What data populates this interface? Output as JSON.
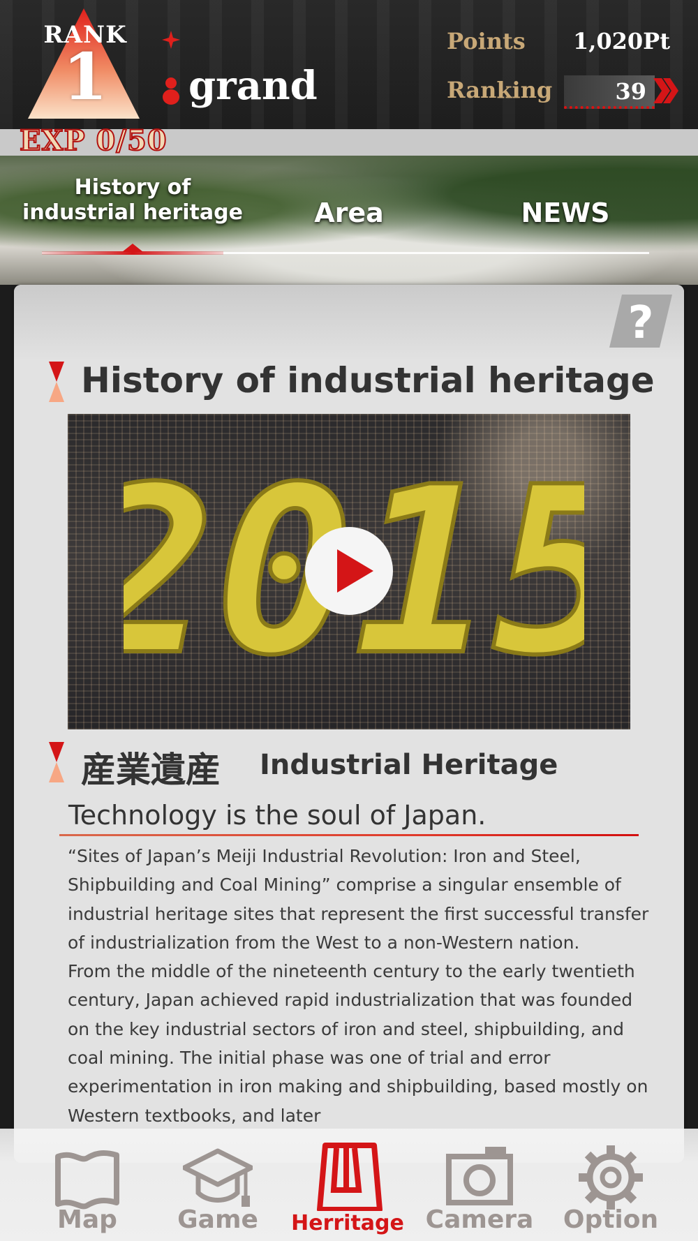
{
  "header": {
    "rank_label": "RANK",
    "rank_number": "1",
    "username": "grand",
    "points_label": "Points",
    "points_value": "1,020Pt",
    "ranking_label": "Ranking",
    "ranking_value": "39",
    "exp_text": "EXP 0/50"
  },
  "tabs": {
    "history_line1": "History of",
    "history_line2": "industrial heritage",
    "area": "Area",
    "news": "NEWS"
  },
  "content": {
    "heading": "History of industrial heritage",
    "video_year_text": "2015",
    "subheading_jp": "産業遺産",
    "subheading_en": "Industrial Heritage",
    "tagline": "Technology is the soul of Japan.",
    "paragraph1": "“Sites of Japan’s Meiji Industrial Revolution: Iron and Steel, Shipbuilding and Coal Mining” comprise a singular ensemble of industrial heritage sites that represent the first successful transfer of industrialization from the West to a non-Western nation.",
    "paragraph2": "From the middle of the nineteenth century to the early twentieth century, Japan achieved rapid industrialization that was founded on the key industrial sectors of iron and steel, shipbuilding, and coal mining. The initial phase was one of trial and error experimentation in iron making and shipbuilding, based mostly on Western textbooks, and later"
  },
  "nav": {
    "items": [
      {
        "label": "Map",
        "icon": "map-icon",
        "active": false
      },
      {
        "label": "Game",
        "icon": "graduation-cap-icon",
        "active": false
      },
      {
        "label": "Herritage",
        "icon": "heritage-building-icon",
        "active": true
      },
      {
        "label": "Camera",
        "icon": "camera-icon",
        "active": false
      },
      {
        "label": "Option",
        "icon": "gear-icon",
        "active": false
      }
    ]
  },
  "colors": {
    "accent_red": "#d41517",
    "gold_label": "#c8a877",
    "nav_inactive": "#9d9592"
  }
}
